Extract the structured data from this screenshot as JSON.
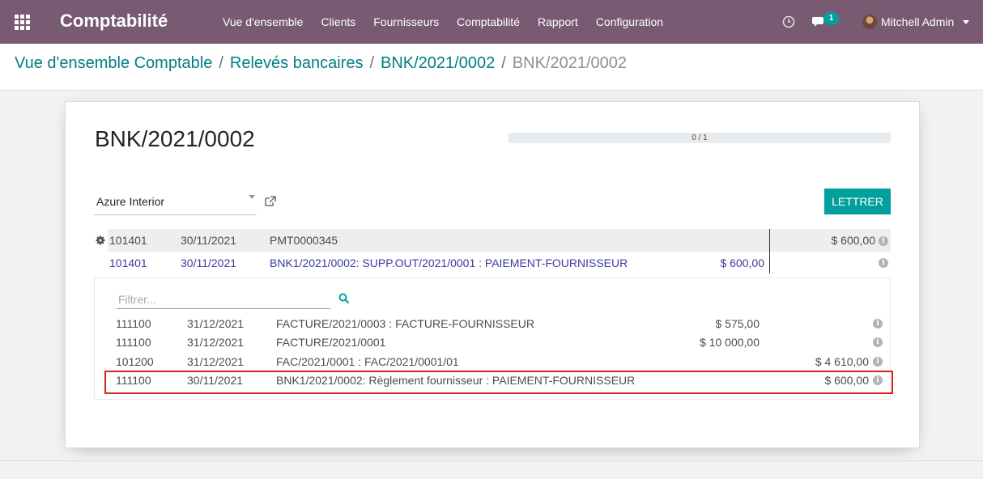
{
  "navbar": {
    "brand": "Comptabilité",
    "menu": [
      "Vue d'ensemble",
      "Clients",
      "Fournisseurs",
      "Comptabilité",
      "Rapport",
      "Configuration"
    ],
    "chat_count": "1",
    "user": "Mitchell Admin"
  },
  "breadcrumb": {
    "items": [
      "Vue d'ensemble Comptable",
      "Relevés bancaires",
      "BNK/2021/0002"
    ],
    "current": "BNK/2021/0002",
    "separator": "/"
  },
  "record": {
    "title": "BNK/2021/0002",
    "progress": "0 / 1",
    "partner": "Azure Interior",
    "lettrer_label": "LETTRER"
  },
  "statement_line": {
    "account": "101401",
    "date": "30/11/2021",
    "label": "PMT0000345",
    "amount": "$ 600,00"
  },
  "matched_line": {
    "account": "101401",
    "date": "30/11/2021",
    "label": "BNK1/2021/0002: SUPP.OUT/2021/0001 : PAIEMENT-FOURNISSEUR",
    "debit": "$ 600,00"
  },
  "propositions": {
    "filter_placeholder": "Filtrer...",
    "rows": [
      {
        "account": "111100",
        "date": "31/12/2021",
        "label": "FACTURE/2021/0003 : FACTURE-FOURNISSEUR",
        "debit": "$ 575,00",
        "credit": ""
      },
      {
        "account": "111100",
        "date": "31/12/2021",
        "label": "FACTURE/2021/0001",
        "debit": "$ 10 000,00",
        "credit": ""
      },
      {
        "account": "101200",
        "date": "31/12/2021",
        "label": "FAC/2021/0001 : FAC/2021/0001/01",
        "debit": "",
        "credit": "$ 4 610,00"
      },
      {
        "account": "111100",
        "date": "30/11/2021",
        "label": "BNK1/2021/0002: Règlement fournisseur : PAIEMENT-FOURNISSEUR",
        "debit": "",
        "credit": "$ 600,00"
      }
    ]
  },
  "colors": {
    "navbar": "#785a73",
    "accent": "#00a09d",
    "link": "#017e84",
    "highlight": "#d9221c"
  }
}
